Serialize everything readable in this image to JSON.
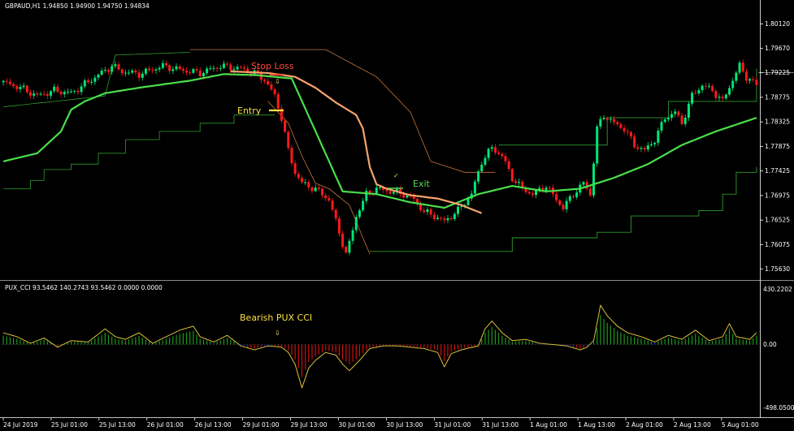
{
  "main_header": "GBPAUD,H1  1.94850 1.94900 1.94750 1.94834",
  "indicator_header": "PUX_CCI 93.5462 140.2743 93.5462 0.0000 0.0000",
  "annotations": {
    "stop_loss": "Stop Loss",
    "entry": "Entry",
    "exit": "Exit",
    "bearish": "Bearish PUX CCI",
    "check_mark": "✓",
    "arrow_glyph": "⇩"
  },
  "colors": {
    "background": "#000000",
    "bull_candle": "#00e676",
    "bear_candle": "#ff1a1a",
    "ma_green": "#4ade4a",
    "ma_orange": "#f5a36c",
    "band_green": "#2e9a2e",
    "band_orange": "#c7773a",
    "cci_line": "#d8c23a",
    "hist_green": "#1e9a1e",
    "hist_red": "#d01010",
    "hist_blue": "#2020e0",
    "annot_red": "#ff4a3a",
    "annot_yellow": "#ffe040",
    "annot_green": "#5cdc5c",
    "separator": "#8a8a8a"
  },
  "price_axis": {
    "labels": [
      "1.80120",
      "1.79670",
      "1.79225",
      "1.78775",
      "1.78325",
      "1.77875",
      "1.77425",
      "1.76975",
      "1.76525",
      "1.76075",
      "1.75630"
    ],
    "current_price_label": "1.79225"
  },
  "indicator_axis": {
    "labels": [
      "430.2202",
      "0.00",
      "-498.0500"
    ]
  },
  "time_axis": {
    "labels": [
      "24 Jul 2019",
      "25 Jul 01:00",
      "25 Jul 13:00",
      "26 Jul 01:00",
      "26 Jul 13:00",
      "29 Jul 01:00",
      "29 Jul 13:00",
      "30 Jul 01:00",
      "30 Jul 13:00",
      "31 Jul 01:00",
      "31 Jul 13:00",
      "1 Aug 01:00",
      "1 Aug 13:00",
      "2 Aug 01:00",
      "2 Aug 13:00",
      "5 Aug 01:00"
    ]
  },
  "chart_data": {
    "type": "candlestick",
    "symbol": "GBPAUD",
    "timeframe": "H1",
    "last_ohlc": [
      1.9485,
      1.949,
      1.9475,
      1.94834
    ],
    "price_range": [
      1.7553,
      1.8035
    ],
    "close_path": [
      [
        0,
        1.7905
      ],
      [
        5,
        1.7895
      ],
      [
        10,
        1.788
      ],
      [
        15,
        1.789
      ],
      [
        20,
        1.7885
      ],
      [
        26,
        1.791
      ],
      [
        32,
        1.7935
      ],
      [
        35,
        1.7925
      ],
      [
        40,
        1.792
      ],
      [
        47,
        1.7935
      ],
      [
        52,
        1.7928
      ],
      [
        58,
        1.7922
      ],
      [
        64,
        1.7935
      ],
      [
        70,
        1.793
      ],
      [
        74,
        1.7922
      ],
      [
        77,
        1.791
      ],
      [
        80,
        1.788
      ],
      [
        82,
        1.784
      ],
      [
        84,
        1.778
      ],
      [
        86,
        1.774
      ],
      [
        88,
        1.772
      ],
      [
        90,
        1.7715
      ],
      [
        93,
        1.7705
      ],
      [
        96,
        1.769
      ],
      [
        98,
        1.765
      ],
      [
        100,
        1.761
      ],
      [
        101,
        1.759
      ],
      [
        102,
        1.761
      ],
      [
        104,
        1.766
      ],
      [
        107,
        1.77
      ],
      [
        110,
        1.771
      ],
      [
        114,
        1.7705
      ],
      [
        118,
        1.77
      ],
      [
        121,
        1.769
      ],
      [
        124,
        1.7668
      ],
      [
        127,
        1.766
      ],
      [
        130,
        1.765
      ],
      [
        134,
        1.767
      ],
      [
        138,
        1.77
      ],
      [
        141,
        1.776
      ],
      [
        144,
        1.7785
      ],
      [
        147,
        1.777
      ],
      [
        150,
        1.773
      ],
      [
        153,
        1.771
      ],
      [
        156,
        1.77
      ],
      [
        160,
        1.7715
      ],
      [
        163,
        1.769
      ],
      [
        165,
        1.7675
      ],
      [
        168,
        1.77
      ],
      [
        171,
        1.772
      ],
      [
        173,
        1.77
      ],
      [
        175,
        1.782
      ],
      [
        177,
        1.7845
      ],
      [
        180,
        1.783
      ],
      [
        183,
        1.782
      ],
      [
        186,
        1.779
      ],
      [
        189,
        1.778
      ],
      [
        192,
        1.78
      ],
      [
        195,
        1.784
      ],
      [
        198,
        1.785
      ],
      [
        200,
        1.783
      ],
      [
        203,
        1.788
      ],
      [
        206,
        1.79
      ],
      [
        209,
        1.789
      ],
      [
        212,
        1.787
      ],
      [
        215,
        1.791
      ],
      [
        217,
        1.7935
      ],
      [
        219,
        1.7915
      ],
      [
        222,
        1.79
      ]
    ],
    "ma_green": [
      [
        0,
        1.776
      ],
      [
        10,
        1.7775
      ],
      [
        17,
        1.7815
      ],
      [
        20,
        1.7855
      ],
      [
        24,
        1.787
      ],
      [
        30,
        1.7885
      ],
      [
        40,
        1.7895
      ],
      [
        55,
        1.7908
      ],
      [
        65,
        1.792
      ],
      [
        75,
        1.7918
      ],
      [
        85,
        1.7912
      ],
      [
        100,
        1.7705
      ],
      [
        110,
        1.77
      ],
      [
        120,
        1.7685
      ],
      [
        130,
        1.7675
      ],
      [
        140,
        1.77
      ],
      [
        150,
        1.7715
      ],
      [
        160,
        1.7705
      ],
      [
        170,
        1.771
      ],
      [
        180,
        1.773
      ],
      [
        190,
        1.7755
      ],
      [
        200,
        1.779
      ],
      [
        210,
        1.7815
      ],
      [
        222,
        1.784
      ]
    ],
    "ma_orange": [
      [
        67,
        1.7925
      ],
      [
        78,
        1.7922
      ],
      [
        86,
        1.7915
      ],
      [
        92,
        1.7895
      ],
      [
        98,
        1.7868
      ],
      [
        104,
        1.7845
      ],
      [
        106,
        1.782
      ],
      [
        108,
        1.775
      ],
      [
        110,
        1.7718
      ],
      [
        113,
        1.771
      ],
      [
        120,
        1.7698
      ],
      [
        128,
        1.7692
      ],
      [
        135,
        1.768
      ],
      [
        141,
        1.7665
      ]
    ],
    "upper_band_green": [
      [
        0,
        1.786
      ],
      [
        30,
        1.788
      ],
      [
        33,
        1.7955
      ],
      [
        55,
        1.796
      ]
    ],
    "lower_band_green": [
      [
        0,
        1.771
      ],
      [
        8,
        1.7725
      ],
      [
        12,
        1.7745
      ],
      [
        20,
        1.7755
      ],
      [
        28,
        1.7775
      ],
      [
        36,
        1.78
      ],
      [
        46,
        1.7815
      ],
      [
        58,
        1.783
      ],
      [
        68,
        1.7845
      ],
      [
        80,
        1.7845
      ]
    ],
    "upper_band_orange": [
      [
        55,
        1.7965
      ],
      [
        95,
        1.7965
      ],
      [
        110,
        1.7915
      ],
      [
        120,
        1.785
      ],
      [
        126,
        1.776
      ],
      [
        136,
        1.774
      ],
      [
        145,
        1.774
      ]
    ],
    "lower_band_orange": [
      [
        78,
        1.787
      ],
      [
        84,
        1.783
      ],
      [
        88,
        1.777
      ],
      [
        92,
        1.772
      ],
      [
        96,
        1.771
      ],
      [
        102,
        1.768
      ],
      [
        108,
        1.759
      ]
    ],
    "trail_green_resist": [
      [
        146,
        1.779
      ],
      [
        170,
        1.779
      ],
      [
        178,
        1.784
      ],
      [
        196,
        1.787
      ],
      [
        222,
        1.793
      ]
    ],
    "trail_green_support": [
      [
        108,
        1.7595
      ],
      [
        146,
        1.7595
      ],
      [
        150,
        1.762
      ],
      [
        175,
        1.763
      ],
      [
        185,
        1.766
      ],
      [
        205,
        1.767
      ],
      [
        212,
        1.77
      ],
      [
        216,
        1.774
      ],
      [
        222,
        1.775
      ]
    ],
    "cci_path": [
      [
        0,
        90
      ],
      [
        4,
        60
      ],
      [
        8,
        10
      ],
      [
        12,
        50
      ],
      [
        16,
        -20
      ],
      [
        20,
        30
      ],
      [
        25,
        20
      ],
      [
        30,
        120
      ],
      [
        33,
        60
      ],
      [
        36,
        40
      ],
      [
        40,
        90
      ],
      [
        44,
        10
      ],
      [
        48,
        60
      ],
      [
        52,
        110
      ],
      [
        56,
        140
      ],
      [
        58,
        60
      ],
      [
        62,
        20
      ],
      [
        66,
        70
      ],
      [
        70,
        -10
      ],
      [
        74,
        -40
      ],
      [
        78,
        -10
      ],
      [
        82,
        -20
      ],
      [
        84,
        -60
      ],
      [
        86,
        -150
      ],
      [
        88,
        -330
      ],
      [
        90,
        -180
      ],
      [
        92,
        -120
      ],
      [
        95,
        -60
      ],
      [
        98,
        -80
      ],
      [
        100,
        -150
      ],
      [
        102,
        -200
      ],
      [
        105,
        -120
      ],
      [
        108,
        -30
      ],
      [
        112,
        -10
      ],
      [
        116,
        -10
      ],
      [
        120,
        -20
      ],
      [
        124,
        -30
      ],
      [
        128,
        -60
      ],
      [
        130,
        -170
      ],
      [
        132,
        -70
      ],
      [
        135,
        -40
      ],
      [
        140,
        -10
      ],
      [
        142,
        120
      ],
      [
        144,
        180
      ],
      [
        147,
        90
      ],
      [
        150,
        30
      ],
      [
        154,
        40
      ],
      [
        158,
        10
      ],
      [
        162,
        0
      ],
      [
        166,
        -10
      ],
      [
        170,
        -40
      ],
      [
        172,
        -20
      ],
      [
        174,
        30
      ],
      [
        176,
        300
      ],
      [
        178,
        220
      ],
      [
        181,
        140
      ],
      [
        184,
        90
      ],
      [
        188,
        60
      ],
      [
        192,
        20
      ],
      [
        196,
        70
      ],
      [
        200,
        40
      ],
      [
        204,
        110
      ],
      [
        208,
        30
      ],
      [
        212,
        60
      ],
      [
        214,
        160
      ],
      [
        216,
        60
      ],
      [
        220,
        40
      ],
      [
        222,
        90
      ]
    ],
    "cci_range": [
      -498.05,
      430.2202
    ]
  }
}
